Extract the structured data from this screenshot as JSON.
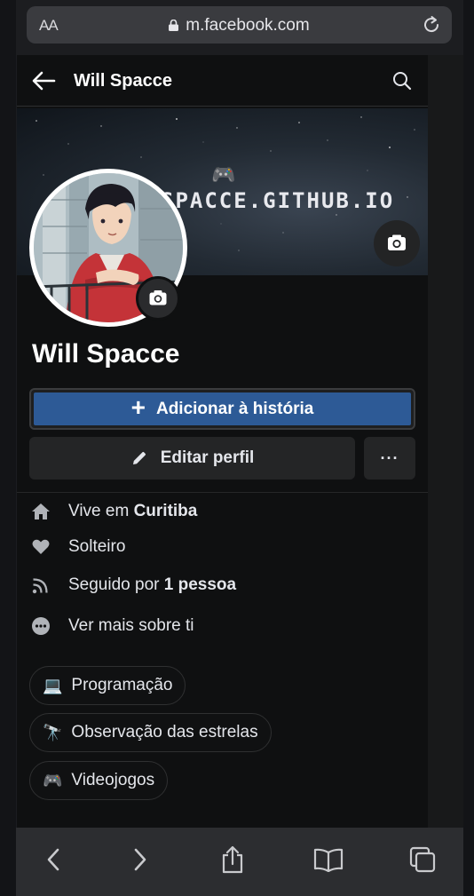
{
  "browser": {
    "text_size_label": "AA",
    "url": "m.facebook.com"
  },
  "header": {
    "title": "Will Spacce"
  },
  "cover": {
    "text": "SPACCE.GITHUB.IO",
    "gamepad_emoji": "🎮"
  },
  "profile": {
    "name": "Will Spacce",
    "add_story_label": "Adicionar à história",
    "edit_profile_label": "Editar perfil",
    "more_label": "···"
  },
  "intro": {
    "lives_prefix": "Vive em ",
    "lives_city": "Curitiba",
    "relationship": "Solteiro",
    "followed_prefix": "Seguido por ",
    "followed_count": "1 pessoa",
    "see_more": "Ver mais sobre ti"
  },
  "hobbies": [
    {
      "emoji": "💻",
      "label": "Programação"
    },
    {
      "emoji": "🔭",
      "label": "Observação das estrelas"
    },
    {
      "emoji": "🎮",
      "label": "Videojogos"
    }
  ],
  "colors": {
    "primary_button": "#2d5a96",
    "background": "#0f1011",
    "secondary_button": "#242526"
  }
}
